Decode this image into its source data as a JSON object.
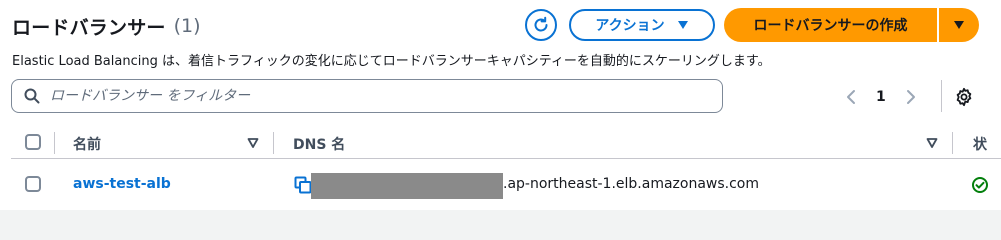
{
  "header": {
    "title": "ロードバランサー",
    "count": "(1)"
  },
  "toolbar": {
    "refresh_icon": "refresh-icon",
    "actions_label": "アクション",
    "create_label": "ロードバランサーの作成"
  },
  "description": "Elastic Load Balancing は、着信トラフィックの変化に応じてロードバランサーキャパシティーを自動的にスケーリングします。",
  "filter": {
    "placeholder": "ロードバランサー をフィルター"
  },
  "pagination": {
    "current_page": "1"
  },
  "table": {
    "columns": [
      "名前",
      "DNS 名",
      "状"
    ],
    "rows": [
      {
        "name": "aws-test-alb",
        "dns_suffix": ".ap-northeast-1.elb.amazonaws.com"
      }
    ]
  },
  "colors": {
    "accent": "#0972d3",
    "primary_button": "#ff9900",
    "success": "#037f0c"
  }
}
